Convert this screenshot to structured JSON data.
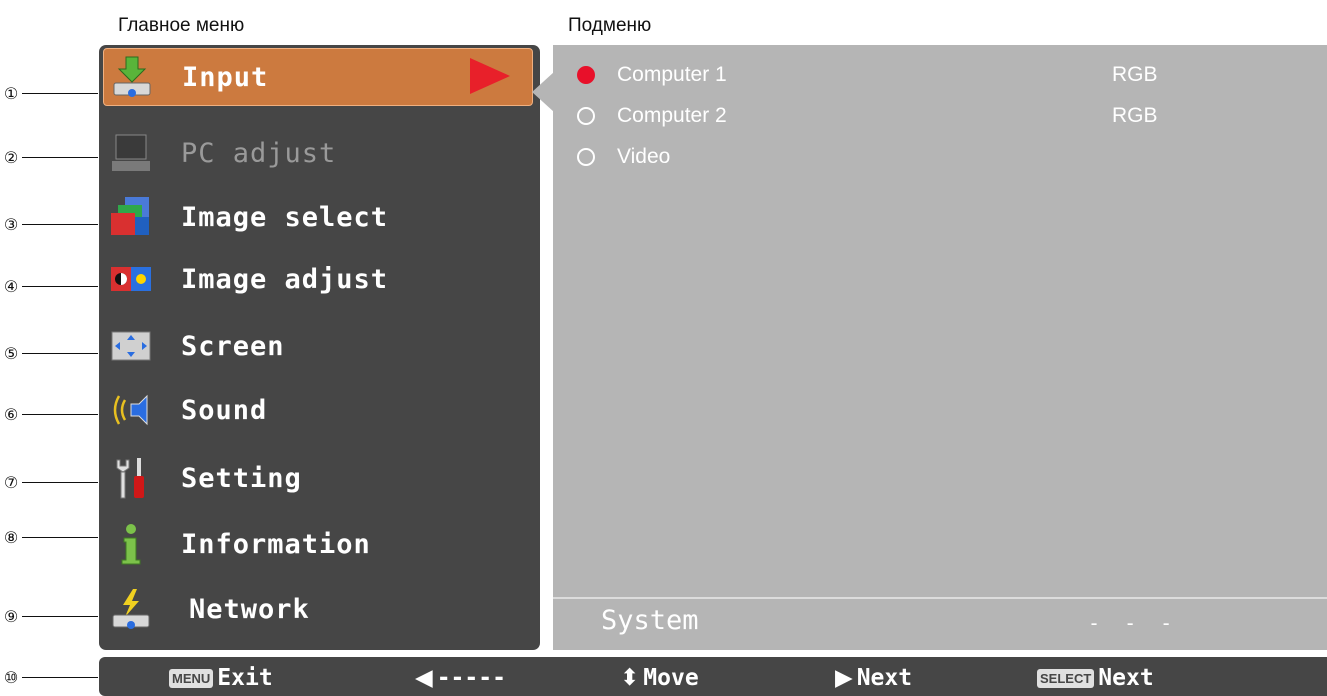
{
  "captions": {
    "main_menu": "Главное меню",
    "submenu": "Подменю"
  },
  "callouts": [
    "①",
    "②",
    "③",
    "④",
    "⑤",
    "⑥",
    "⑦",
    "⑧",
    "⑨",
    "⑩"
  ],
  "main_menu": {
    "items": [
      {
        "label": "Input",
        "icon": "input-icon",
        "selected": true
      },
      {
        "label": "PC adjust",
        "icon": "pc-adjust-icon",
        "disabled": true
      },
      {
        "label": "Image select",
        "icon": "image-select-icon"
      },
      {
        "label": "Image adjust",
        "icon": "image-adjust-icon"
      },
      {
        "label": "Screen",
        "icon": "screen-icon"
      },
      {
        "label": "Sound",
        "icon": "sound-icon"
      },
      {
        "label": "Setting",
        "icon": "setting-icon"
      },
      {
        "label": "Information",
        "icon": "information-icon"
      },
      {
        "label": "Network",
        "icon": "network-icon"
      }
    ]
  },
  "submenu": {
    "options": [
      {
        "label": "Computer 1",
        "value": "RGB",
        "selected": true
      },
      {
        "label": "Computer 2",
        "value": "RGB",
        "selected": false
      },
      {
        "label": "Video",
        "value": "",
        "selected": false
      }
    ],
    "system_label": "System",
    "system_value": "- - -"
  },
  "statusbar": {
    "exit_key": "MENU",
    "exit": "Exit",
    "back": "-----",
    "move": "Move",
    "next": "Next",
    "select_key": "SELECT",
    "select_next": "Next"
  },
  "colors": {
    "menu_bg": "#464646",
    "selected": "#cc7a3f",
    "submenu_bg": "#b5b5b5",
    "accent": "#e8102a"
  }
}
